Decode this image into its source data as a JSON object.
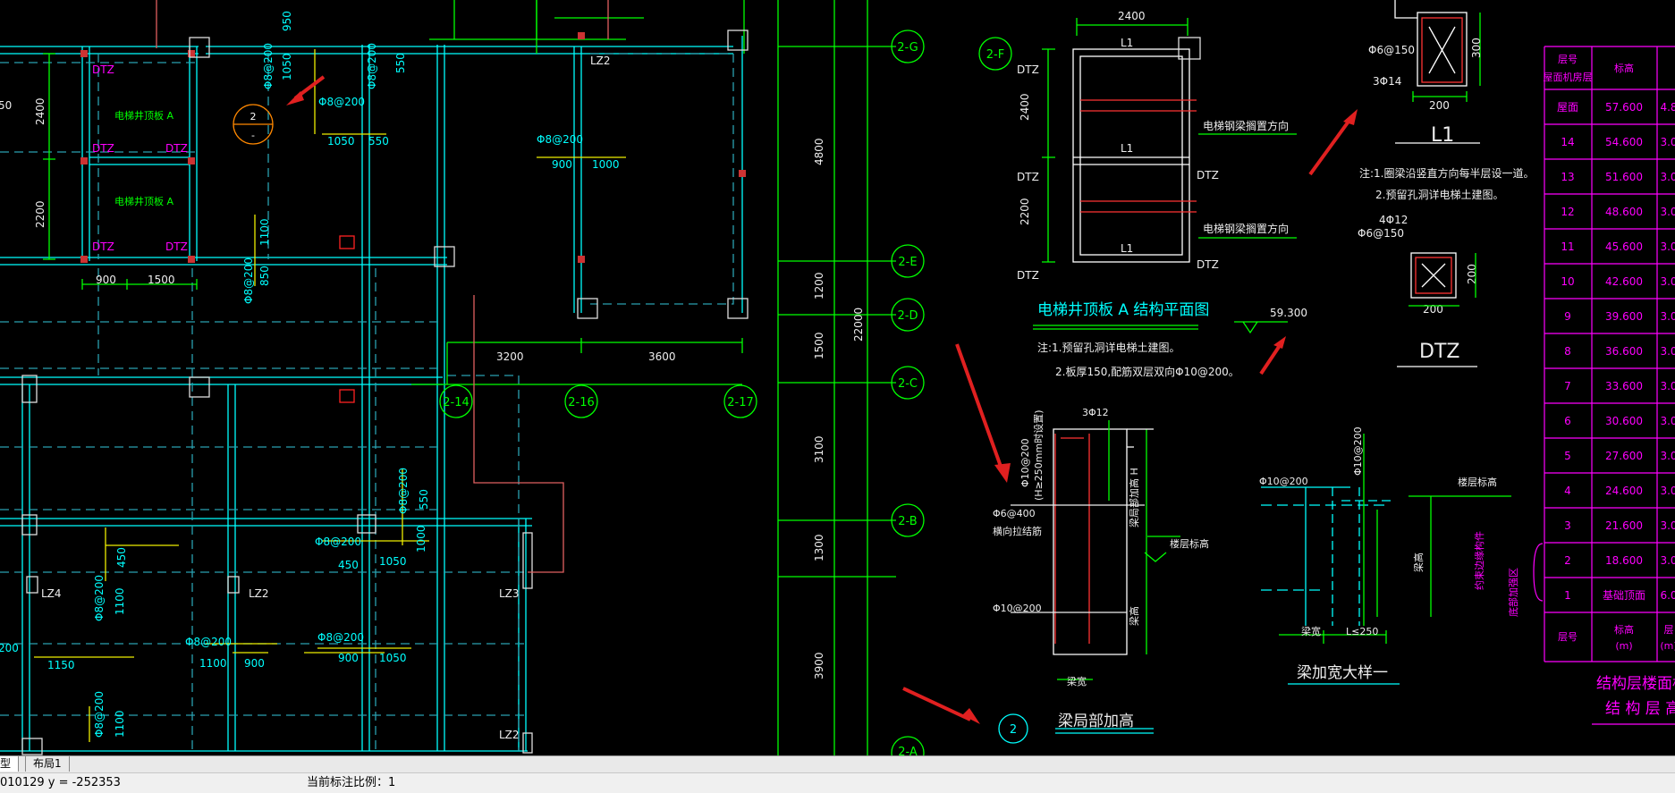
{
  "drawing": {
    "axis_labels": {
      "a2G": "2-G",
      "a2E": "2-E",
      "a2D": "2-D",
      "a2C": "2-C",
      "a2B": "2-B",
      "a2A": "2-A",
      "a2F": "2-F",
      "a214": "2-14",
      "a216": "2-16",
      "a217": "2-17"
    },
    "vertical_dims": [
      "4800",
      "1200",
      "1500",
      "3100",
      "1300",
      "3900"
    ],
    "total_dim": "22000",
    "horiz_dims": [
      "3200",
      "3600"
    ],
    "left_dims": {
      "d2400": "2400",
      "d2200": "2200",
      "d900": "900",
      "d1500": "1500",
      "d50": "50"
    },
    "room_labels": {
      "shaft_a1": "电梯井顶板 A",
      "shaft_a2": "电梯井顶板 A"
    },
    "column_tags": {
      "dtz": "DTZ",
      "lz2": "LZ2",
      "lz3": "LZ3",
      "lz4": "LZ4"
    },
    "rebar": {
      "r1": "Φ8@200",
      "r2": "Φ8@200",
      "r3": "Φ8@200",
      "r4": "Φ8@200",
      "r5": "Φ8@200",
      "r6": "Φ8@200",
      "r7": "Φ8@200",
      "r8": "Φ8@200",
      "r9": "Φ8@200",
      "r10": "Φ8@200",
      "r11": "Φ8@200"
    },
    "rebar_lengths": {
      "n950": "950",
      "n1050": "1050",
      "n550": "550",
      "n900": "900",
      "n1000": "1000",
      "n1100": "1100",
      "n850": "850",
      "n450": "450",
      "n1150": "1150",
      "n200": "200"
    },
    "callout": {
      "top": "2",
      "bottom": "-"
    },
    "plan_a": {
      "dim_top": "2400",
      "dim_2400": "2400",
      "dim_2200": "2200",
      "l1": "L1",
      "dtz": "DTZ",
      "note_a": "电梯钢梁搁置方向",
      "title": "电梯井顶板 A  结构平面图",
      "note1": "注:1.预留孔洞详电梯土建图。",
      "note2": "2.板厚150,配筋双层双向Φ10@200。",
      "elev": "59.300"
    },
    "section_l1": {
      "bar1": "Φ6@150",
      "bar2": "3Φ14",
      "w": "200",
      "h": "300",
      "name": "L1",
      "note1": "注:1.圈梁沿竖直方向每半层设一道。",
      "note2": "2.预留孔洞详电梯土建图。"
    },
    "section_dtz": {
      "bar1": "4Φ12",
      "bar2": "Φ6@150",
      "w": "200",
      "h": "200",
      "name": "DTZ"
    },
    "detail_beam_raise": {
      "top_bar": "3Φ12",
      "stirrup": "Φ10@200",
      "note": "(H≥250mm时设置)",
      "side_bar": "Φ6@400",
      "side_note": "横向拉结筋",
      "beam_h": "梁局部加高 H",
      "floor_mark": "楼层标高",
      "beam_height": "梁高",
      "bottom_bar": "Φ10@200",
      "beam_width": "梁宽",
      "title": "梁局部加高",
      "number": "2"
    },
    "detail_beam_widen": {
      "bar_left": "Φ10@200",
      "bar_right": "Φ10@200",
      "floor_mark": "楼层标高",
      "beam_height": "梁高",
      "beam_width": "梁宽",
      "widen": "L≤250",
      "title": "梁加宽大样一"
    },
    "floor_table": {
      "header_floor": "层号",
      "header_elev": "标高",
      "header_h": "层",
      "header_floor_unit": "屋面机房层",
      "header_elev_unit": "(m)",
      "header_h_unit": "(m)",
      "header_top": "标高",
      "rows": [
        {
          "floor": "屋面",
          "elev": "57.600",
          "h": "4.8"
        },
        {
          "floor": "14",
          "elev": "54.600",
          "h": "3.0"
        },
        {
          "floor": "13",
          "elev": "51.600",
          "h": "3.0"
        },
        {
          "floor": "12",
          "elev": "48.600",
          "h": "3.0"
        },
        {
          "floor": "11",
          "elev": "45.600",
          "h": "3.0"
        },
        {
          "floor": "10",
          "elev": "42.600",
          "h": "3.0"
        },
        {
          "floor": "9",
          "elev": "39.600",
          "h": "3.0"
        },
        {
          "floor": "8",
          "elev": "36.600",
          "h": "3.0"
        },
        {
          "floor": "7",
          "elev": "33.600",
          "h": "3.0"
        },
        {
          "floor": "6",
          "elev": "30.600",
          "h": "3.0"
        },
        {
          "floor": "5",
          "elev": "27.600",
          "h": "3.0"
        },
        {
          "floor": "4",
          "elev": "24.600",
          "h": "3.0"
        },
        {
          "floor": "3",
          "elev": "21.600",
          "h": "3.0"
        },
        {
          "floor": "2",
          "elev": "18.600",
          "h": "3.0"
        },
        {
          "floor": "1",
          "elev": "基础顶面",
          "h": "6.0"
        }
      ],
      "side_note_1": "约束边缘构件",
      "side_note_2": "底部加强区",
      "title1": "结构层楼面标高",
      "title2": "结 构 层 高"
    }
  },
  "tabs": {
    "model": "型",
    "layout1": "布局1"
  },
  "status": {
    "coords": "010129 y = -252353",
    "scale": "当前标注比例：1"
  }
}
